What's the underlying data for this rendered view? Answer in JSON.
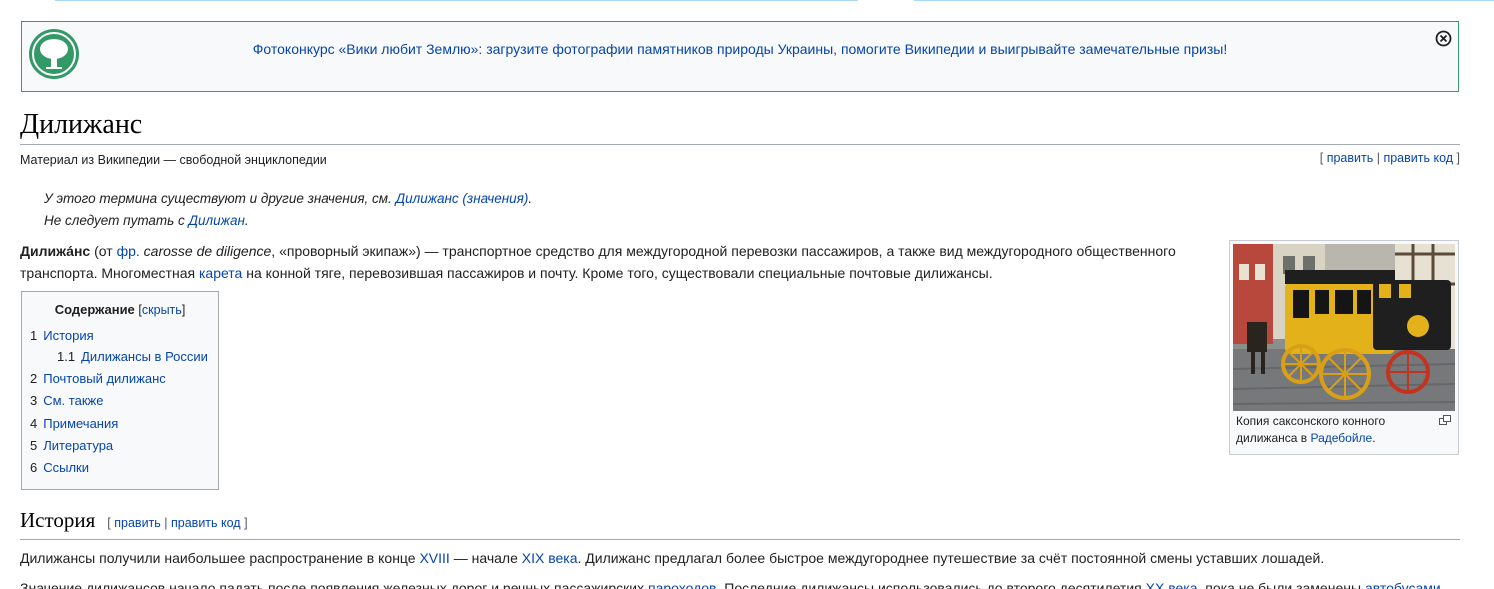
{
  "notice": {
    "text": "Фотоконкурс «Вики любит Землю»: загрузите фотографии памятников природы Украины, помогите Википедии и выигрывайте замечательные призы!"
  },
  "article": {
    "title": "Дилижанс",
    "subtitle": "Материал из Википедии — свободной энциклопедии",
    "edit": "править",
    "edit_source": "править код"
  },
  "hatnotes": {
    "line1_text": "У этого термина существуют и другие значения, см. ",
    "line1_link": "Дилижанс (значения)",
    "line1_end": ".",
    "line2_text": "Не следует путать с ",
    "line2_link": "Дилижан",
    "line2_end": "."
  },
  "intro": {
    "term": "Дилижа́нс",
    "t1": " (от ",
    "fr_link": "фр.",
    "fr_word": "carosse de diligence",
    "t2": ", «проворный экипаж») — транспортное средство для междугородной перевозки пассажиров, а также вид междугородного общественного",
    "t3": "транспорта. Многоместная ",
    "kareta_link": "карета",
    "t4": " на конной тяге, перевозившая пассажиров и почту. Кроме того, существовали специальные почтовые дилижансы."
  },
  "toc": {
    "title": "Содержание",
    "toggle": "скрыть",
    "items": [
      {
        "num": "1",
        "label": "История"
      },
      {
        "num": "1.1",
        "label": "Дилижансы в России"
      },
      {
        "num": "2",
        "label": "Почтовый дилижанс"
      },
      {
        "num": "3",
        "label": "См. также"
      },
      {
        "num": "4",
        "label": "Примечания"
      },
      {
        "num": "5",
        "label": "Литература"
      },
      {
        "num": "6",
        "label": "Ссылки"
      }
    ]
  },
  "thumb": {
    "caption_text": "Копия саксонского конного дилижанса в ",
    "caption_link": "Радебойле",
    "caption_end": "."
  },
  "history": {
    "heading": "История",
    "edit": "править",
    "edit_source": "править код",
    "p1_a": "Дилижансы получили наибольшее распространение в конце ",
    "p1_link1": "XVIII",
    "p1_b": " — начале ",
    "p1_link2": "XIX века",
    "p1_c": ". Дилижанс предлагал более быстрое междугороднее путешествие за счёт постоянной смены уставших лошадей.",
    "p2_a": "Значение дилижансов начало падать после появления железных дорог и речных пассажирских ",
    "p2_link1": "пароходов",
    "p2_b": ". Последние дилижансы использовались до второго десятилетия ",
    "p2_link2": "XX века",
    "p2_c": ", пока не были заменены ",
    "p2_link3": "автобусами"
  },
  "colors": {
    "link": "#0645ad",
    "notice_border": "#3a9a6e",
    "notice_icon": "#339966"
  }
}
